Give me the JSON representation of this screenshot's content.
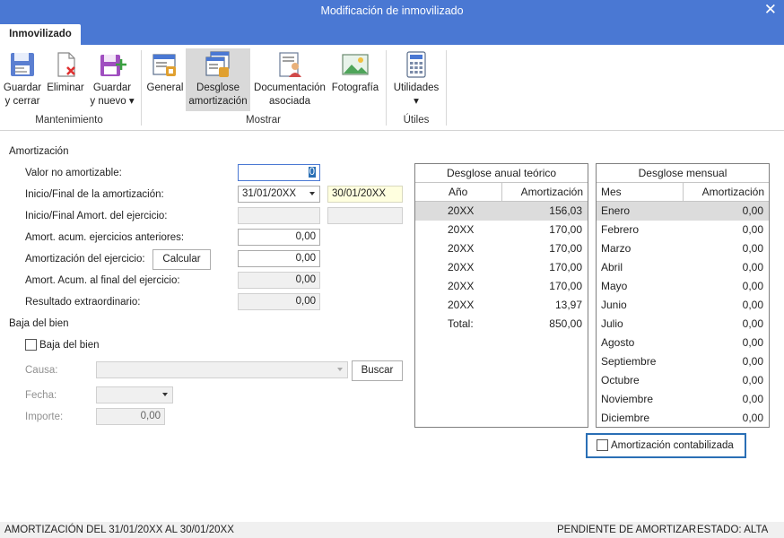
{
  "window": {
    "title": "Modificación de inmovilizado"
  },
  "tabs": [
    "Inmovilizado"
  ],
  "ribbon": {
    "buttons": [
      {
        "line1": "Guardar",
        "line2": "y cerrar",
        "icon": "save-close-icon"
      },
      {
        "line1": "Eliminar",
        "line2": "",
        "icon": "delete-icon"
      },
      {
        "line1": "Guardar",
        "line2": "y nuevo ▾",
        "icon": "save-new-icon"
      },
      {
        "line1": "General",
        "line2": "",
        "icon": "general-icon"
      },
      {
        "line1": "Desglose",
        "line2": "amortización",
        "icon": "breakdown-icon"
      },
      {
        "line1": "Documentación",
        "line2": "asociada",
        "icon": "documents-icon"
      },
      {
        "line1": "Fotografía",
        "line2": "",
        "icon": "photo-icon"
      },
      {
        "line1": "Utilidades",
        "line2": "▾",
        "icon": "calculator-icon"
      }
    ],
    "groups": [
      "Mantenimiento",
      "Mostrar",
      "Útiles"
    ]
  },
  "amortizacion": {
    "section_title": "Amortización",
    "valor_no_amortizable_label": "Valor no amortizable:",
    "valor_no_amortizable_value": "0",
    "inicio_final_label": "Inicio/Final de la amortización:",
    "inicio_value": "31/01/20XX",
    "final_value": "30/01/20XX",
    "inicio_final_ejercicio_label": "Inicio/Final Amort. del ejercicio:",
    "acum_anteriores_label": "Amort. acum. ejercicios anteriores:",
    "acum_anteriores_value": "0,00",
    "amort_ejercicio_label": "Amortización del ejercicio:",
    "calcular_label": "Calcular",
    "amort_ejercicio_value": "0,00",
    "acum_final_label": "Amort. Acum. al final del ejercicio:",
    "acum_final_value": "0,00",
    "resultado_label": "Resultado extraordinario:",
    "resultado_value": "0,00"
  },
  "baja": {
    "section_title": "Baja del bien",
    "checkbox_label": "Baja del bien",
    "causa_label": "Causa:",
    "buscar_label": "Buscar",
    "fecha_label": "Fecha:",
    "importe_label": "Importe:",
    "importe_value": "0,00"
  },
  "desglose_anual": {
    "title": "Desglose anual teórico",
    "col_year": "Año",
    "col_amount": "Amortización",
    "rows": [
      {
        "year": "20XX",
        "amount": "156,03"
      },
      {
        "year": "20XX",
        "amount": "170,00"
      },
      {
        "year": "20XX",
        "amount": "170,00"
      },
      {
        "year": "20XX",
        "amount": "170,00"
      },
      {
        "year": "20XX",
        "amount": "170,00"
      },
      {
        "year": "20XX",
        "amount": "13,97"
      }
    ],
    "total_label": "Total:",
    "total_value": "850,00"
  },
  "desglose_mensual": {
    "title": "Desglose mensual",
    "col_month": "Mes",
    "col_amount": "Amortización",
    "rows": [
      {
        "month": "Enero",
        "amount": "0,00"
      },
      {
        "month": "Febrero",
        "amount": "0,00"
      },
      {
        "month": "Marzo",
        "amount": "0,00"
      },
      {
        "month": "Abril",
        "amount": "0,00"
      },
      {
        "month": "Mayo",
        "amount": "0,00"
      },
      {
        "month": "Junio",
        "amount": "0,00"
      },
      {
        "month": "Julio",
        "amount": "0,00"
      },
      {
        "month": "Agosto",
        "amount": "0,00"
      },
      {
        "month": "Septiembre",
        "amount": "0,00"
      },
      {
        "month": "Octubre",
        "amount": "0,00"
      },
      {
        "month": "Noviembre",
        "amount": "0,00"
      },
      {
        "month": "Diciembre",
        "amount": "0,00"
      }
    ],
    "contabilizada_label": "Amortización contabilizada"
  },
  "status": {
    "left": "AMORTIZACIÓN DEL 31/01/20XX AL 30/01/20XX",
    "pendiente": "PENDIENTE DE AMORTIZAR",
    "estado": "ESTADO: ALTA"
  },
  "colors": {
    "titlebar": "#4a78d3",
    "focus_border": "#2a6fb5",
    "selected_row": "#dcdcdc"
  }
}
